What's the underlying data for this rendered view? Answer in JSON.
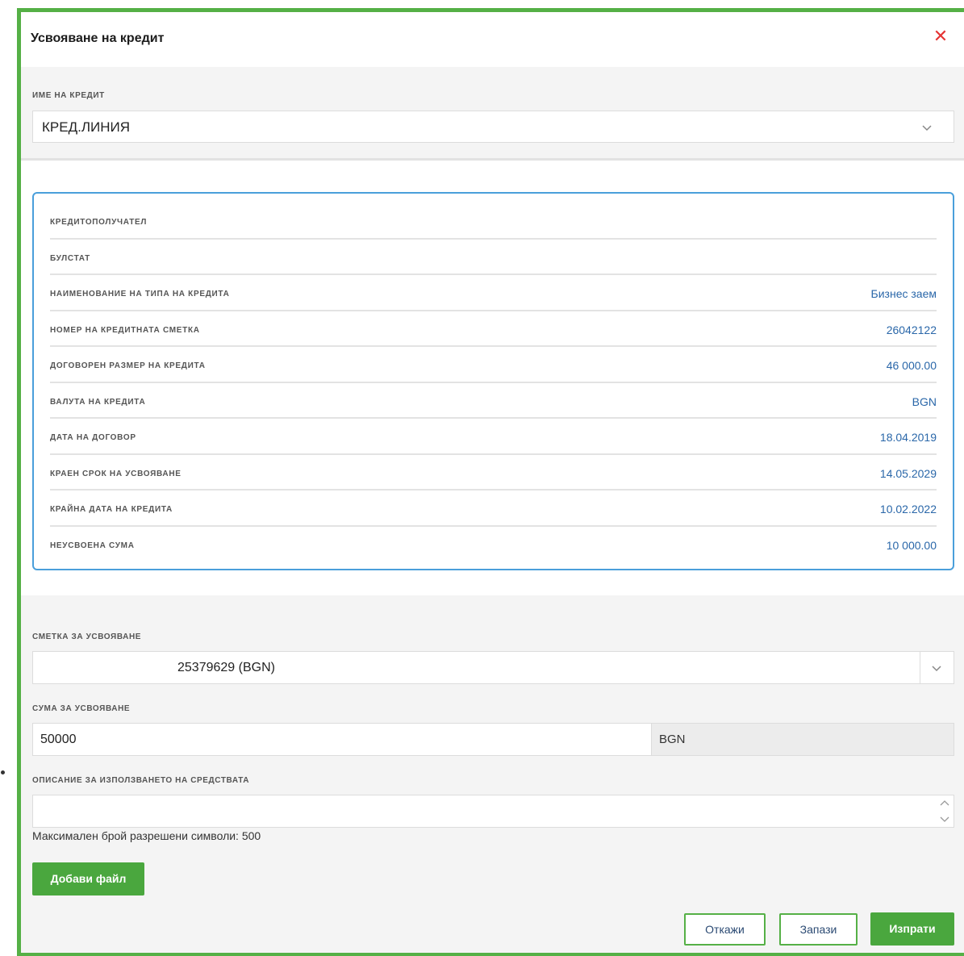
{
  "modal": {
    "title": "Усвояване на кредит"
  },
  "credit_name": {
    "label": "ИМЕ НА КРЕДИТ",
    "value": "КРЕД.ЛИНИЯ"
  },
  "details": [
    {
      "label": "КРЕДИТОПОЛУЧАТЕЛ",
      "value": ""
    },
    {
      "label": "БУЛСТАТ",
      "value": ""
    },
    {
      "label": "НАИМЕНОВАНИЕ НА ТИПА НА КРЕДИТА",
      "value": "Бизнес заем"
    },
    {
      "label": "НОМЕР НА КРЕДИТНАТА СМЕТКА",
      "value": "26042122"
    },
    {
      "label": "ДОГОВОРЕН РАЗМЕР НА КРЕДИТА",
      "value": "46 000.00"
    },
    {
      "label": "ВАЛУТА НА КРЕДИТА",
      "value": "BGN"
    },
    {
      "label": "ДАТА НА ДОГОВОР",
      "value": "18.04.2019"
    },
    {
      "label": "КРАЕН СРОК НА УСВОЯВАНЕ",
      "value": "14.05.2029"
    },
    {
      "label": "КРАЙНА ДАТА НА КРЕДИТА",
      "value": "10.02.2022"
    },
    {
      "label": "НЕУСВОЕНА СУМА",
      "value": "10 000.00"
    }
  ],
  "account": {
    "label": "СМЕТКА ЗА УСВОЯВАНЕ",
    "value": "25379629 (BGN)"
  },
  "amount": {
    "label": "СУМА ЗА УСВОЯВАНЕ",
    "value": "50000",
    "currency": "BGN"
  },
  "description": {
    "label": "ОПИСАНИЕ ЗА ИЗПОЛЗВАНЕТО НА СРЕДСТВАТА",
    "value": "",
    "hint": "Максимален брой разрешени символи: 500"
  },
  "buttons": {
    "add_file": "Добави файл",
    "cancel": "Откажи",
    "save": "Запази",
    "send": "Изпрати"
  },
  "colors": {
    "accent_green": "#4aa73e",
    "card_border_blue": "#4a9fdb",
    "value_blue": "#2a67a9",
    "close_red": "#e53333"
  },
  "icons": {
    "close": "close-icon",
    "dropdown": "chevron-down-icon",
    "spinner": "spinner-arrows-icon"
  }
}
